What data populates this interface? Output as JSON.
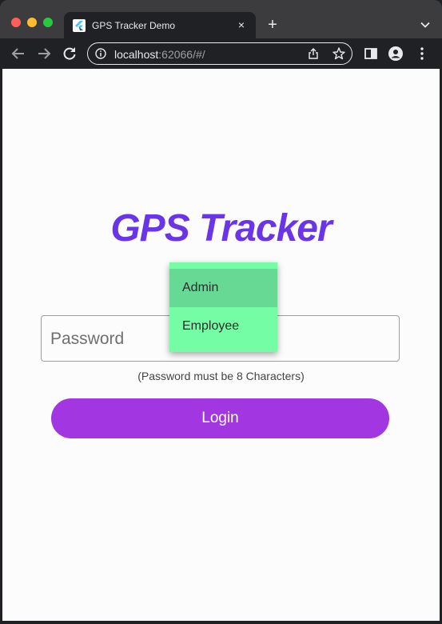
{
  "browser": {
    "tab_title": "GPS Tracker Demo",
    "tab_close": "×",
    "new_tab": "+",
    "url_host": "localhost",
    "url_rest": ":62066/#/"
  },
  "app": {
    "title": "GPS Tracker",
    "password_placeholder": "Password",
    "password_hint": "(Password must be 8 Characters)",
    "login_label": "Login",
    "role_menu": {
      "options": [
        "Admin",
        "Employee"
      ],
      "highlighted": "Admin"
    }
  },
  "colors": {
    "title": "#6a35e8",
    "login_button": "#a236e0",
    "menu_background": "#74fda5",
    "menu_highlight": "#68d995"
  },
  "icons": [
    "back-arrow-icon",
    "forward-arrow-icon",
    "reload-icon",
    "info-icon",
    "share-icon",
    "star-icon",
    "side-panel-icon",
    "profile-icon",
    "kebab-menu-icon",
    "flutter-favicon",
    "chevron-down-icon"
  ]
}
